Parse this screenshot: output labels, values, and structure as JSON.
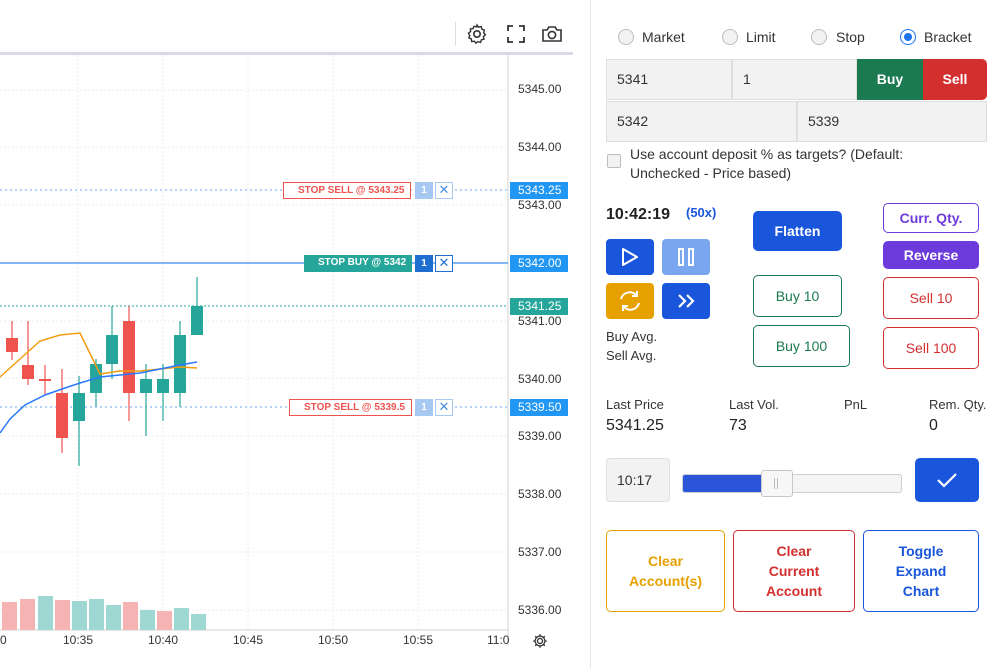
{
  "chart": {
    "price_axis": [
      "5345.00",
      "5344.00",
      "5343.00",
      "5341.00",
      "5340.00",
      "5339.00",
      "5338.00",
      "5337.00",
      "5336.00"
    ],
    "time_axis": [
      "0",
      "10:35",
      "10:40",
      "10:45",
      "10:50",
      "10:55",
      "11:0"
    ],
    "orders": [
      {
        "label": "STOP SELL @ 5343.25",
        "qty": "1",
        "price": "5343.25",
        "side": "sell"
      },
      {
        "label": "STOP BUY @ 5342",
        "qty": "1",
        "price": "5342.00",
        "side": "buy"
      },
      {
        "label": "STOP SELL @ 5339.5",
        "qty": "1",
        "price": "5339.50",
        "side": "sell"
      }
    ],
    "last_price_tag": "5341.25",
    "colors": {
      "up": "#26a69a",
      "down": "#ef5350",
      "buy_line": "#2196f3",
      "sell_tag": "#2196f3",
      "ma_blue": "#2979ff",
      "ma_orange": "#f39c12"
    },
    "icons": {
      "settings": "gear-icon",
      "fullscreen": "fullscreen-icon",
      "screenshot": "camera-icon",
      "axis_settings": "gear-icon"
    }
  },
  "order_type": {
    "options": [
      {
        "label": "Market",
        "selected": false
      },
      {
        "label": "Limit",
        "selected": false
      },
      {
        "label": "Stop",
        "selected": false
      },
      {
        "label": "Bracket",
        "selected": true
      }
    ]
  },
  "entry": {
    "price": "5341",
    "qty": "1",
    "buy_label": "Buy",
    "sell_label": "Sell",
    "target": "5342",
    "stop": "5339"
  },
  "deposit_option": {
    "label": "Use account deposit % as targets? (Default: Unchecked - Price based)",
    "checked": false
  },
  "clock": {
    "time": "10:42:19",
    "speed": "(50x)"
  },
  "playback": {
    "play": "play-icon",
    "pause": "pause-icon",
    "refresh": "refresh-icon",
    "fast_forward": "fast-forward-icon"
  },
  "averages": {
    "buy": "Buy Avg.",
    "sell": "Sell Avg."
  },
  "actions": {
    "flatten": "Flatten",
    "curr_qty": "Curr. Qty.",
    "reverse": "Reverse",
    "buy10": "Buy 10",
    "sell10": "Sell 10",
    "buy100": "Buy 100",
    "sell100": "Sell 100"
  },
  "stats": {
    "last_price_label": "Last Price",
    "last_price": "5341.25",
    "last_vol_label": "Last Vol.",
    "last_vol": "73",
    "pnl_label": "PnL",
    "pnl": "",
    "rem_qty_label": "Rem. Qty.",
    "rem_qty": "0"
  },
  "jump": {
    "time": "10:17",
    "slider_fraction": 0.43,
    "confirm_icon": "check-icon"
  },
  "footer": {
    "clear_accounts": "Clear Account(s)",
    "clear_current": "Clear Current Account",
    "toggle_chart": "Toggle Expand Chart"
  },
  "colors": {
    "buy": "#1b7a4f",
    "sell": "#d32f2f",
    "primary": "#1a56db",
    "purple": "#6d3bdb",
    "orange": "#e6a000"
  }
}
